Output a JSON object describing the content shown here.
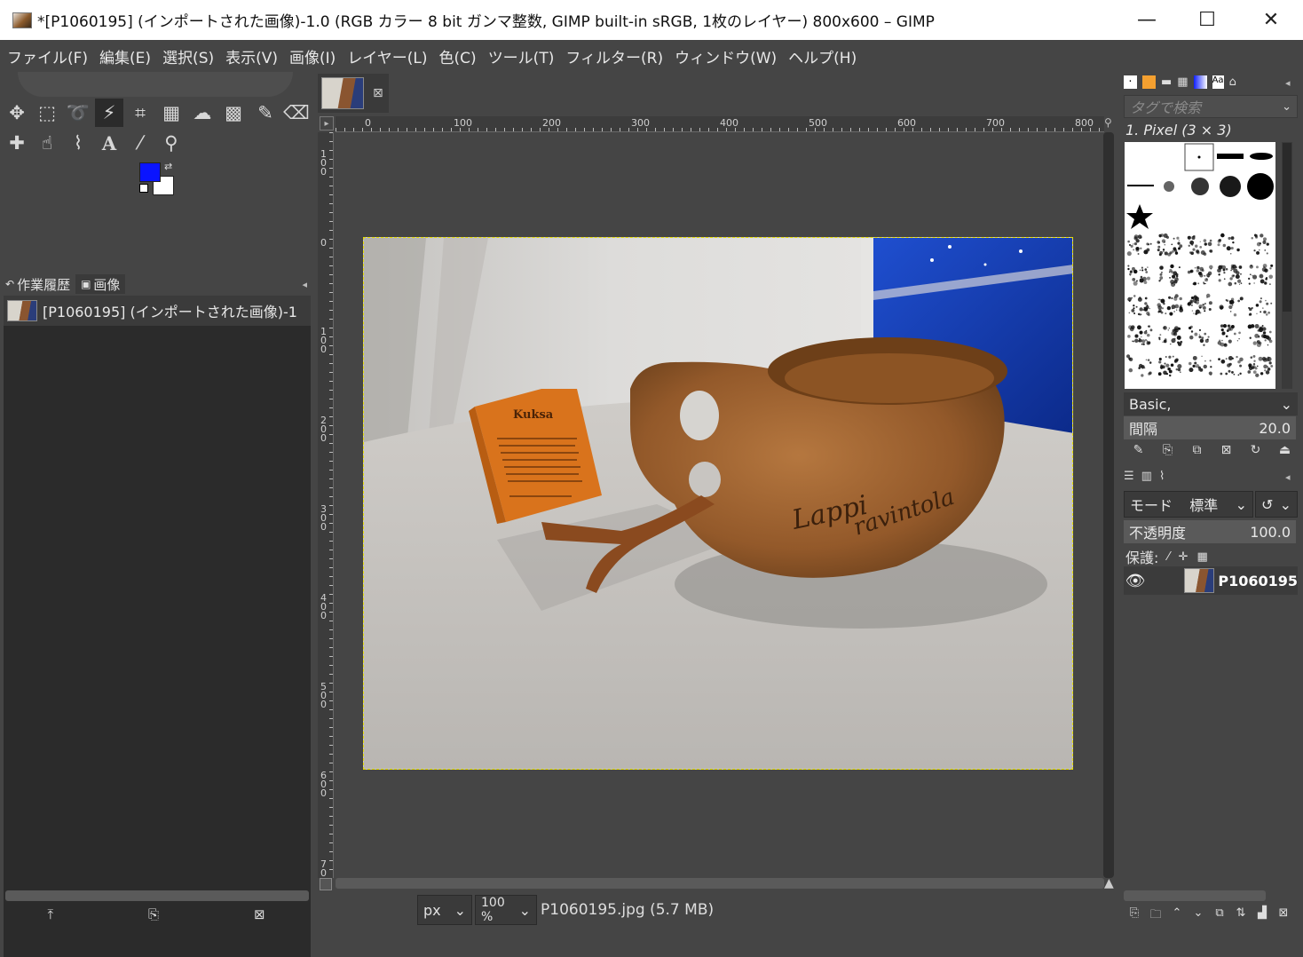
{
  "window": {
    "title": "*[P1060195] (インポートされた画像)-1.0 (RGB カラー 8 bit ガンマ整数, GIMP built-in sRGB, 1枚のレイヤー) 800x600 – GIMP",
    "minimize": "—",
    "maximize": "☐",
    "close": "✕"
  },
  "menu": [
    "ファイル(F)",
    "編集(E)",
    "選択(S)",
    "表示(V)",
    "画像(I)",
    "レイヤー(L)",
    "色(C)",
    "ツール(T)",
    "フィルター(R)",
    "ウィンドウ(W)",
    "ヘルプ(H)"
  ],
  "toolbox": {
    "tools_row1": [
      "move-icon",
      "rect-select-icon",
      "lasso-icon",
      "fuzzy-select-icon",
      "crop-icon",
      "unified-transform-icon",
      "warp-icon",
      "gradient-icon",
      "paintbrush-icon",
      "eraser-icon"
    ],
    "tools_row2": [
      "heal-icon",
      "smudge-icon",
      "paths-icon",
      "text-icon",
      "color-picker-icon",
      "zoom-icon"
    ],
    "fg_color": "#0a14ff",
    "bg_color": "#ffffff"
  },
  "left_panel": {
    "tabs": [
      "作業履歴",
      "画像"
    ],
    "image_list": [
      "[P1060195] (インポートされた画像)-1"
    ]
  },
  "ruler": {
    "h_labels": [
      "0",
      "100",
      "200",
      "300",
      "400",
      "500",
      "600",
      "700",
      "800"
    ],
    "v_labels": [
      "100",
      "0",
      "100",
      "200",
      "300",
      "400",
      "500",
      "600",
      "700"
    ]
  },
  "status": {
    "unit": "px",
    "zoom": "100 %",
    "file_info": "P1060195.jpg (5.7 MB)"
  },
  "right_panel": {
    "search_placeholder": "タグで検索",
    "brush_name": "1. Pixel (3 × 3)",
    "brush_preset": "Basic,",
    "spacing_label": "間隔",
    "spacing_value": "20.0",
    "mode_label": "モード",
    "mode_value": "標準",
    "opacity_label": "不透明度",
    "opacity_value": "100.0",
    "lock_label": "保護:",
    "layer_name": "P1060195"
  },
  "photo": {
    "label_title": "Kuksa",
    "cup_text1": "Lappi",
    "cup_text2": "ravintola"
  }
}
